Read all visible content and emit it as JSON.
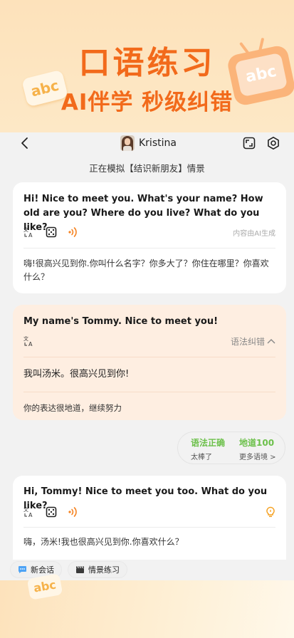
{
  "promo": {
    "title": "口语练习",
    "subtitle": "AI伴学 秒级纠错",
    "sticker_text": "abc"
  },
  "header": {
    "user_name": "Kristina",
    "scene_text": "正在模拟【结识新朋友】情景"
  },
  "messages": [
    {
      "en": "Hi! Nice to meet you. What's your name? How old are you? Where do you live? What do you like?",
      "ai_note": "内容由AI生成",
      "zh": "嗨!很高兴见到你.你叫什么名字？你多大了？你住在哪里？你喜欢什么？"
    },
    {
      "en": "My name's Tommy. Nice to meet you!",
      "grammar_label": "语法纠错",
      "zh": "我叫汤米。很高兴见到你!",
      "feedback": "你的表达很地道，继续努力"
    },
    {
      "en": "Hi, Tommy! Nice to meet you too. What do you like?",
      "zh": "嗨，汤米!我也很高兴见到你.你喜欢什么？"
    }
  ],
  "score": {
    "grammar_title": "语法正确",
    "grammar_sub": "太棒了",
    "idiom_title": "地道100",
    "idiom_sub": "更多语境 >"
  },
  "bottom": {
    "new_chat": "新会话",
    "scene_practice": "情景练习"
  },
  "colors": {
    "brand_orange": "#f26a1b",
    "audio_orange": "#f5821f",
    "success_green": "#6cc04a"
  },
  "icons": [
    "back-icon",
    "avatar",
    "fullscreen-icon",
    "settings-icon",
    "translate-icon",
    "dice-icon",
    "audio-icon",
    "chevron-up-icon",
    "lightbulb-icon",
    "chat-icon",
    "clapperboard-icon"
  ]
}
